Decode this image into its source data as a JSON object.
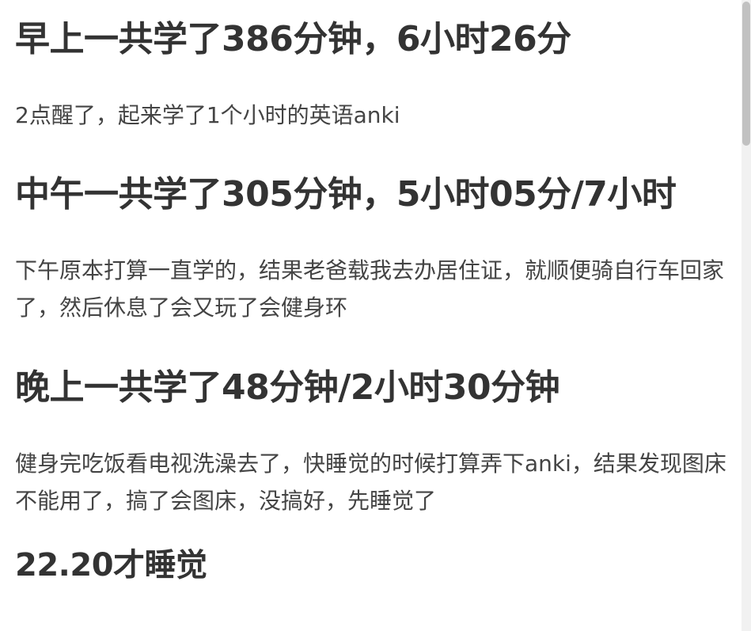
{
  "sections": [
    {
      "heading": "早上一共学了386分钟，6小时26分",
      "text": "2点醒了，起来学了1个小时的英语anki"
    },
    {
      "heading": "中午一共学了305分钟，5小时05分/7小时",
      "text": "下午原本打算一直学的，结果老爸载我去办居住证，就顺便骑自行车回家了，然后休息了会又玩了会健身环"
    },
    {
      "heading": "晚上一共学了48分钟/2小时30分钟",
      "text": "健身完吃饭看电视洗澡去了，快睡觉的时候打算弄下anki，结果发现图床不能用了，搞了会图床，没搞好，先睡觉了"
    }
  ],
  "footer_heading": "22.20才睡觉"
}
